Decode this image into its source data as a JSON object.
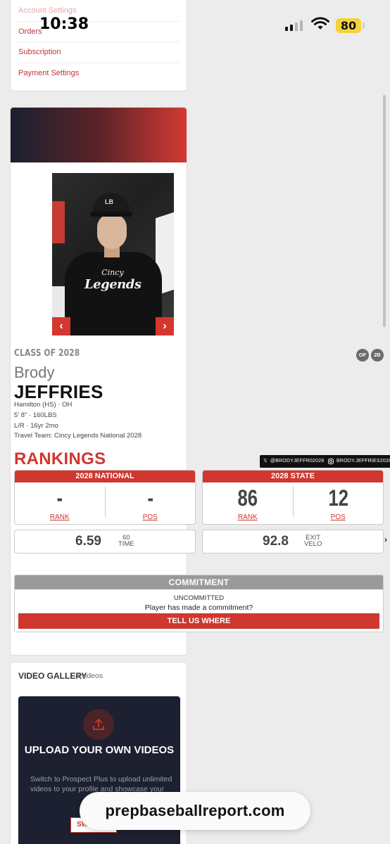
{
  "status_bar": {
    "time": "10:38",
    "battery": "80"
  },
  "account_menu": {
    "items": [
      "Account Settings",
      "Orders",
      "Subscription",
      "Payment Settings"
    ]
  },
  "player": {
    "class_of": "CLASS OF 2028",
    "first_name": "Brody",
    "last_name": "JEFFRIES",
    "school": "Hamilton (HS) · OH",
    "size": "5' 8\" · 160LBS",
    "bats_throws_age": "L/R · 16yr 2mo",
    "travel_team": "Travel Team: Cincy Legends National 2028",
    "positions": [
      "OF",
      "2B"
    ],
    "photo_shirt_line1": "Cincy",
    "photo_shirt_line2": "Legends",
    "photo_cap_logo": "LB"
  },
  "rankings": {
    "title": "RANKINGS",
    "social": {
      "x_handle": "@BRODYJEFFR02028",
      "instagram_handle": "BRODY.JEFFRIES2028"
    },
    "national": {
      "header": "2028 NATIONAL",
      "rank": "-",
      "pos": "-",
      "rank_label": "RANK",
      "pos_label": "POS"
    },
    "state": {
      "header": "2028 STATE",
      "rank": "86",
      "pos": "12",
      "rank_label": "RANK",
      "pos_label": "POS"
    },
    "stats": [
      {
        "value": "6.59",
        "label_line1": "60",
        "label_line2": "TIME"
      },
      {
        "value": "92.8",
        "label_line1": "EXIT",
        "label_line2": "VELO"
      }
    ]
  },
  "commitment": {
    "header": "COMMITMENT",
    "status": "UNCOMMITTED",
    "question": "Player has made a commitment?",
    "button": "TELL US WHERE"
  },
  "video_gallery": {
    "title": "VIDEO GALLERY",
    "count": "3 videos",
    "upload_title": "UPLOAD YOUR OWN VIDEOS",
    "upload_desc": "Switch to Prospect Plus to upload unlimited videos to your profile and showcase your",
    "upload_button": "SW"
  },
  "browser": {
    "url": "prepbaseballreport.com"
  },
  "colors": {
    "accent": "#d0372f",
    "dark_panel": "#1c2030",
    "commit_head": "#9a9a9a"
  }
}
